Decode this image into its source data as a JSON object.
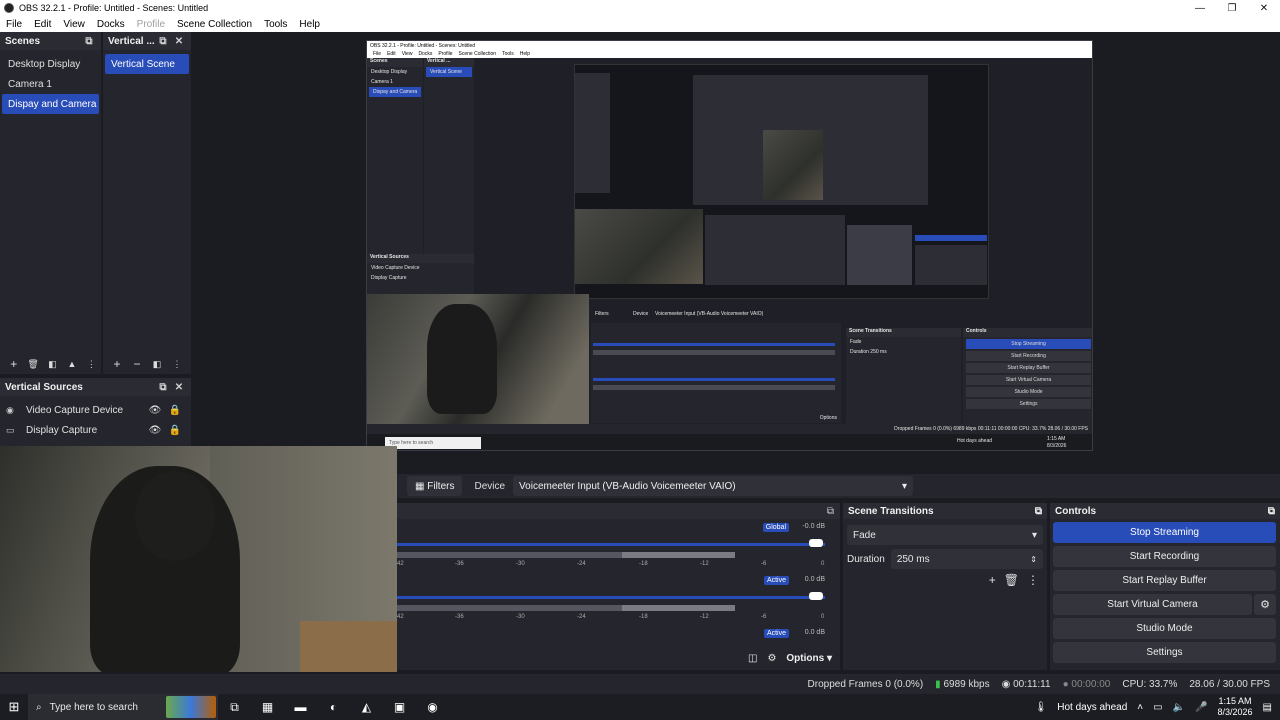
{
  "window": {
    "title": "OBS 32.2.1 - Profile: Untitled - Scenes: Untitled",
    "minimize": "—",
    "maximize": "❐",
    "close": "✕"
  },
  "menu": [
    "File",
    "Edit",
    "View",
    "Docks",
    "Profile",
    "Scene Collection",
    "Tools",
    "Help"
  ],
  "scenes_dock": {
    "title": "Scenes",
    "items": [
      "Desktop Display",
      "Camera 1",
      "Dispay and Camera"
    ],
    "selected_index": 2
  },
  "vertical_scenes_dock": {
    "title": "Vertical ...",
    "items": [
      "Vertical Scene"
    ]
  },
  "vertical_sources_dock": {
    "title": "Vertical Sources",
    "items": [
      {
        "label": "Video Capture Device",
        "icon": "camera-icon"
      },
      {
        "label": "Display Capture",
        "icon": "monitor-icon"
      }
    ]
  },
  "nested_preview": {
    "title": "OBS 32.2.1 - Profile: Untitled - Scenes: Untitled",
    "menu": [
      "File",
      "Edit",
      "View",
      "Docks",
      "Profile",
      "Scene Collection",
      "Tools",
      "Help"
    ],
    "scenes_title": "Scenes",
    "scenes": [
      "Desktop Display",
      "Camera 1",
      "Dispay and Camera"
    ],
    "vertical_title": "Vertical ...",
    "vertical_scene": "Vertical Scene",
    "sources_title": "Vertical Sources",
    "sources": [
      "Video Capture Device",
      "Display Capture"
    ],
    "filters": "Filters",
    "device_label": "Device",
    "device": "Voicemeeter Input (VB-Audio Voicemeeter VAIO)",
    "transitions_title": "Scene Transitions",
    "transition": "Fade",
    "duration_label": "Duration",
    "duration": "250 ms",
    "controls_title": "Controls",
    "controls": [
      "Stop Streaming",
      "Start Recording",
      "Start Replay Buffer",
      "Start Virtual Camera",
      "Studio Mode",
      "Settings"
    ],
    "options": "Options",
    "status": "Dropped Frames 0 (0.0%)   6989 kbps   00:11:11   00:00:00   CPU: 33.7%   28.06 / 30.00 FPS",
    "search": "Type here to search",
    "weather": "Hot days ahead",
    "time": "1:15 AM",
    "date": "8/3/2026"
  },
  "source_props": {
    "filters_label": "Filters",
    "device_label": "Device",
    "device_value": "Voicemeeter Input (VB-Audio Voicemeeter VAIO)"
  },
  "mixer": {
    "tracks": [
      {
        "tag": "Global",
        "db": "-0.0 dB"
      },
      {
        "tag": "Active",
        "db": "0.0 dB"
      },
      {
        "tag": "Active",
        "db": "0.0 dB"
      }
    ],
    "ticks": [
      "42",
      "-36",
      "-30",
      "-24",
      "-18",
      "-12",
      "-6",
      "0"
    ],
    "options_label": "Options"
  },
  "scene_transitions": {
    "title": "Scene Transitions",
    "transition": "Fade",
    "duration_label": "Duration",
    "duration_value": "250 ms"
  },
  "controls": {
    "title": "Controls",
    "stop_streaming": "Stop Streaming",
    "start_recording": "Start Recording",
    "start_replay_buffer": "Start Replay Buffer",
    "start_virtual_camera": "Start Virtual Camera",
    "studio_mode": "Studio Mode",
    "settings": "Settings"
  },
  "status": {
    "dropped_frames": "Dropped Frames 0 (0.0%)",
    "bitrate": "6989 kbps",
    "stream_time": "00:11:11",
    "record_time": "00:00:00",
    "cpu": "CPU: 33.7%",
    "fps": "28.06 / 30.00 FPS"
  },
  "taskbar": {
    "search_placeholder": "Type here to search",
    "weather": "Hot days ahead",
    "time": "1:15 AM",
    "date": "8/3/2026"
  },
  "colors": {
    "accent": "#284cb8",
    "panel": "#25262d",
    "background": "#1b1c22"
  }
}
